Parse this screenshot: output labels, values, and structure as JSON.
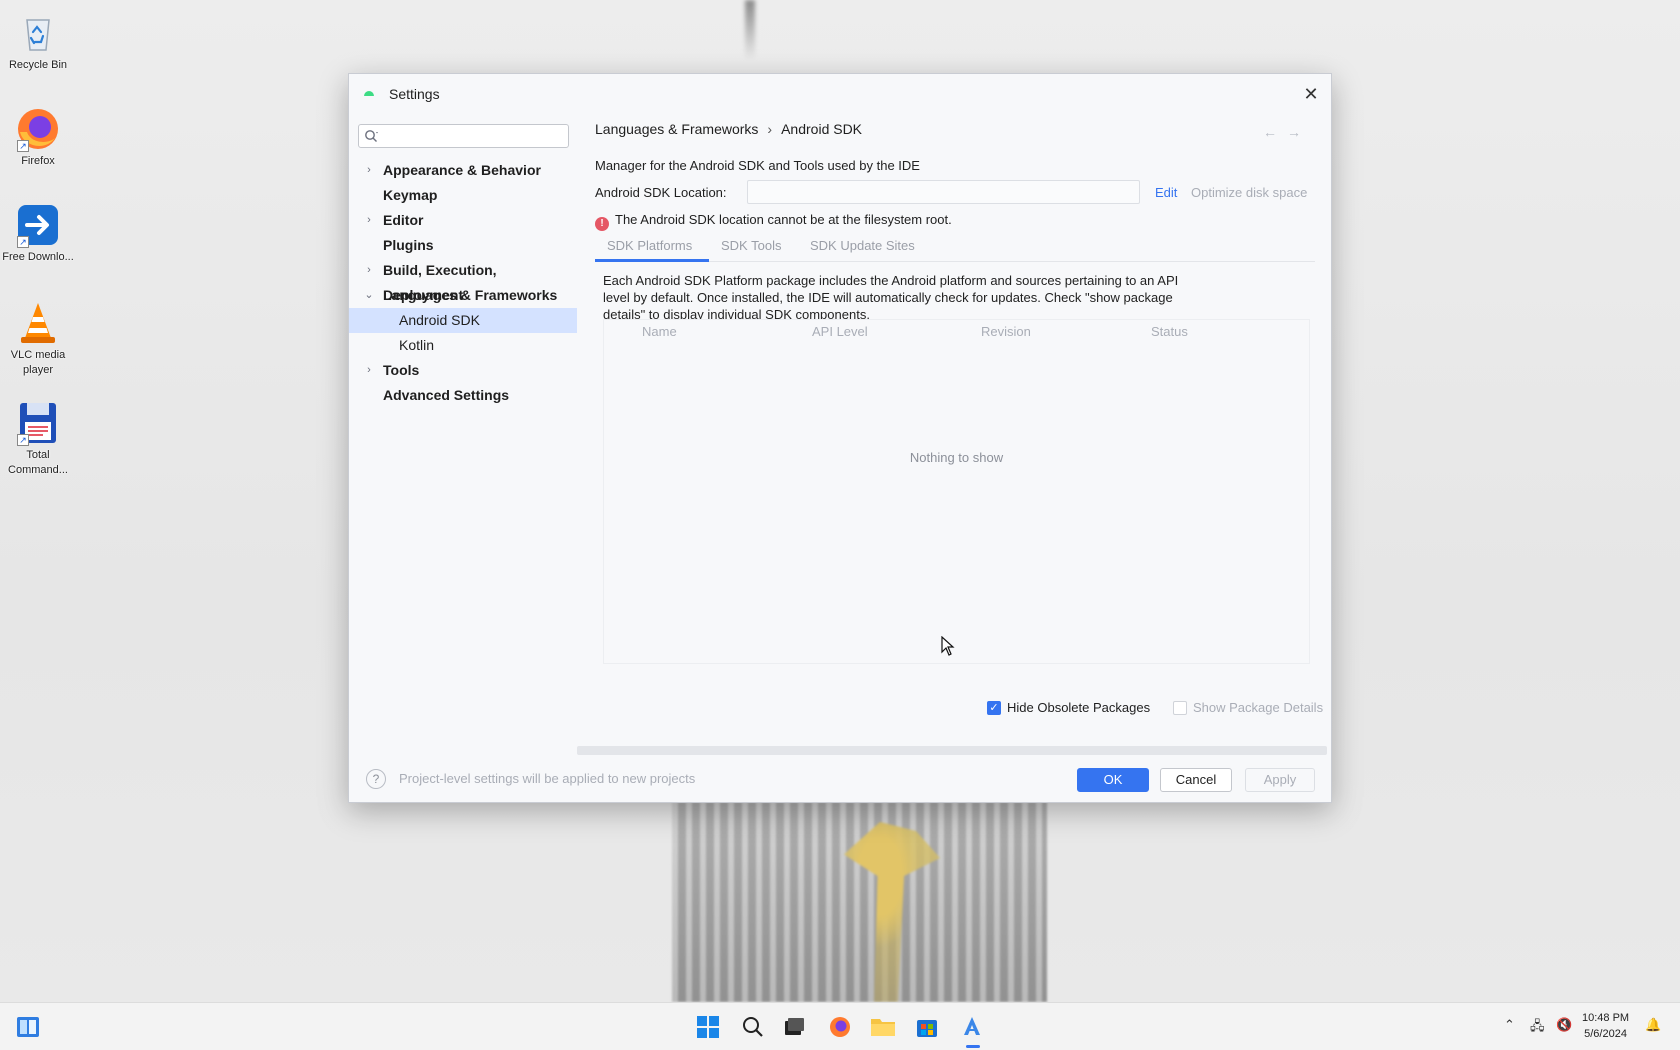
{
  "desktop": {
    "icons": [
      {
        "label": "Recycle Bin"
      },
      {
        "label": "Firefox"
      },
      {
        "label": "Free Downlo..."
      },
      {
        "label": "VLC media player"
      },
      {
        "label": "Total Command..."
      }
    ]
  },
  "dialog": {
    "title": "Settings",
    "search": {
      "value": "",
      "placeholder": ""
    },
    "sidebar": {
      "items": [
        {
          "label": "Appearance & Behavior"
        },
        {
          "label": "Keymap"
        },
        {
          "label": "Editor"
        },
        {
          "label": "Plugins"
        },
        {
          "label": "Build, Execution, Deployment"
        },
        {
          "label": "Languages & Frameworks"
        },
        {
          "label": "Android SDK"
        },
        {
          "label": "Kotlin"
        },
        {
          "label": "Tools"
        },
        {
          "label": "Advanced Settings"
        }
      ]
    },
    "breadcrumb": {
      "parent": "Languages & Frameworks",
      "separator": "›",
      "current": "Android SDK"
    },
    "description": "Manager for the Android SDK and Tools used by the IDE",
    "sdk_location": {
      "label": "Android SDK Location:",
      "value": "",
      "edit": "Edit",
      "optimize": "Optimize disk space"
    },
    "error": "The Android SDK location cannot be at the filesystem root.",
    "tabs": [
      {
        "label": "SDK Platforms"
      },
      {
        "label": "SDK Tools"
      },
      {
        "label": "SDK Update Sites"
      }
    ],
    "tab_description": "Each Android SDK Platform package includes the Android platform and sources pertaining to an API level by default. Once installed, the IDE will automatically check for updates. Check \"show package details\" to display individual SDK components.",
    "table": {
      "columns": [
        "Name",
        "API Level",
        "Revision",
        "Status"
      ],
      "empty": "Nothing to show"
    },
    "options": {
      "hide_obsolete": {
        "label": "Hide Obsolete Packages",
        "checked": true
      },
      "show_details": {
        "label": "Show Package Details",
        "checked": false
      }
    },
    "footer": {
      "help": "?",
      "note": "Project-level settings will be applied to new projects",
      "ok": "OK",
      "cancel": "Cancel",
      "apply": "Apply"
    }
  },
  "taskbar": {
    "time": "10:48 PM",
    "date": "5/6/2024"
  },
  "colors": {
    "accent": "#3574f0",
    "selection": "#d4e2ff",
    "error": "#e55765"
  }
}
